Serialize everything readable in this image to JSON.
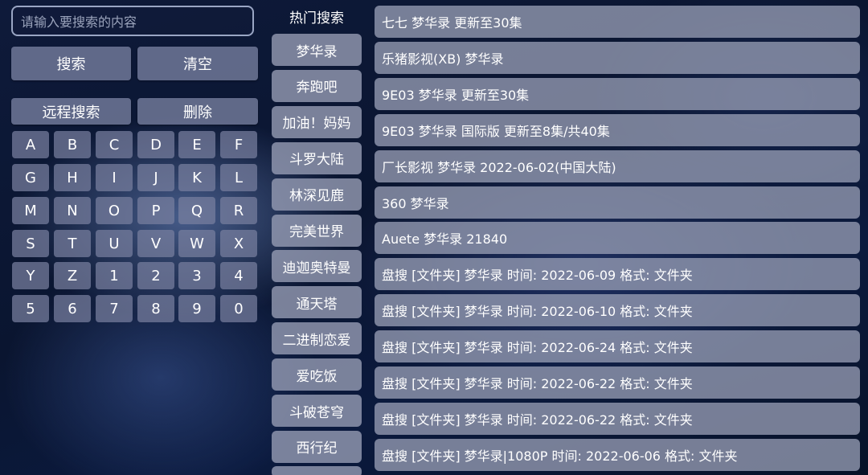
{
  "search": {
    "placeholder": "请输入要搜索的内容",
    "search_label": "搜索",
    "clear_label": "清空",
    "remote_label": "远程搜索",
    "delete_label": "删除"
  },
  "keyboard": {
    "keys": [
      "A",
      "B",
      "C",
      "D",
      "E",
      "F",
      "G",
      "H",
      "I",
      "J",
      "K",
      "L",
      "M",
      "N",
      "O",
      "P",
      "Q",
      "R",
      "S",
      "T",
      "U",
      "V",
      "W",
      "X",
      "Y",
      "Z",
      "1",
      "2",
      "3",
      "4",
      "5",
      "6",
      "7",
      "8",
      "9",
      "0"
    ]
  },
  "hot": {
    "title": "热门搜索",
    "items": [
      "梦华录",
      "奔跑吧",
      "加油！妈妈",
      "斗罗大陆",
      "林深见鹿",
      "完美世界",
      "迪迦奥特曼",
      "通天塔",
      "二进制恋爱",
      "爱吃饭",
      "斗破苍穹",
      "西行纪"
    ]
  },
  "results": [
    "七七 梦华录  更新至30集",
    "乐猪影视(XB) 梦华录",
    "9E03 梦华录  更新至30集",
    "9E03 梦华录 国际版  更新至8集/共40集",
    "厂长影视 梦华录  2022-06-02(中国大陆)",
    "360 梦华录",
    "Auete 梦华录  21840",
    "盘搜 [文件夹] 梦华录 时间: 2022-06-09 格式: 文件夹",
    "盘搜 [文件夹] 梦华录 时间: 2022-06-10 格式: 文件夹",
    "盘搜 [文件夹] 梦华录 时间: 2022-06-24 格式: 文件夹",
    "盘搜 [文件夹] 梦华录 时间: 2022-06-22 格式: 文件夹",
    "盘搜 [文件夹] 梦华录 时间: 2022-06-22 格式: 文件夹",
    "盘搜 [文件夹] 梦华录|1080P 时间: 2022-06-06 格式: 文件夹"
  ]
}
